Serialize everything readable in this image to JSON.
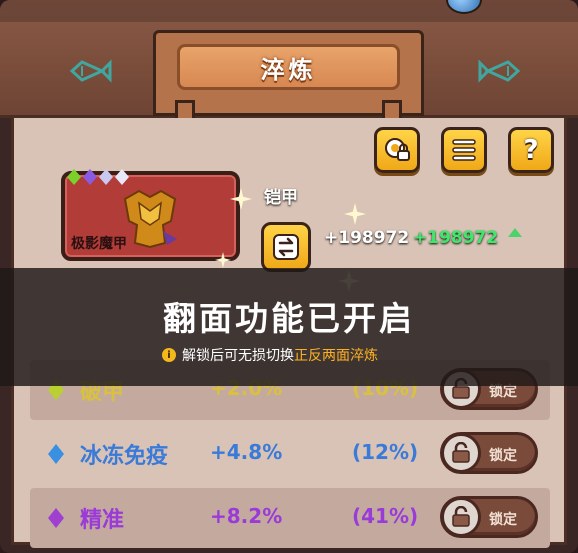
{
  "title": "淬炼",
  "toolbar": {
    "icons": [
      "gear-lock-icon",
      "menu-icon",
      "help-icon"
    ],
    "help_glyph": "?"
  },
  "equipment": {
    "name": "极影魔甲",
    "type": "铠甲",
    "gem_colors": [
      "#7bd12a",
      "#8a5ae0",
      "#c8c8f0",
      "#e8e8f8"
    ],
    "power": "+198972",
    "power_bonus": "+198972"
  },
  "overlay": {
    "title": "翻面功能已开启",
    "tip_prefix": "解锁后可无损切换",
    "tip_highlight": "正反两面淬炼",
    "info_glyph": "i"
  },
  "stats": [
    {
      "name": "破甲",
      "value": "+2.0%",
      "percent": "(10%)",
      "color": "#d8c040",
      "gem": "#b8d030",
      "lock_label": "锁定"
    },
    {
      "name": "冰冻免疫",
      "value": "+4.8%",
      "percent": "(12%)",
      "color": "#3a7ad8",
      "gem": "#3a90e0",
      "lock_label": "锁定"
    },
    {
      "name": "精准",
      "value": "+8.2%",
      "percent": "(41%)",
      "color": "#9a3ad8",
      "gem": "#a040d0",
      "lock_label": "锁定"
    }
  ],
  "colors": {
    "accent_gold": "#f0a818",
    "panel": "#d9c3b6",
    "power_green": "#3ee86a"
  }
}
